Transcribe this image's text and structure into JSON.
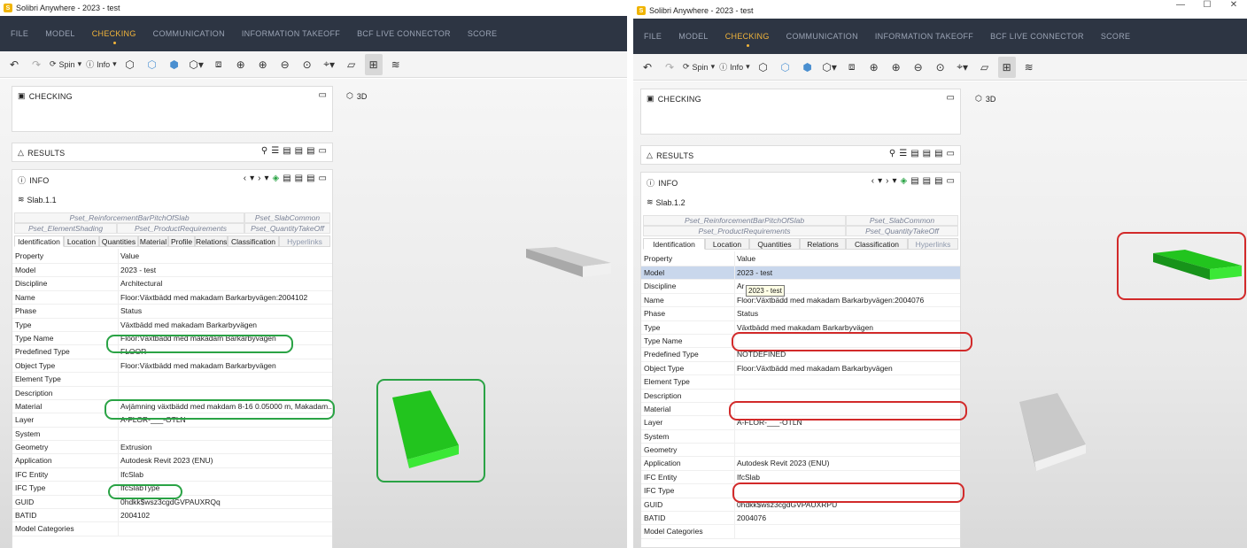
{
  "windows": [
    {
      "title": "Solibri Anywhere - 2023 - test",
      "window_controls": [
        "—",
        "☐",
        "✕"
      ],
      "menu": [
        "FILE",
        "MODEL",
        "CHECKING",
        "COMMUNICATION",
        "INFORMATION TAKEOFF",
        "BCF LIVE CONNECTOR",
        "SCORE"
      ],
      "active_menu": "CHECKING",
      "toolbar": {
        "spin_label": "Spin",
        "info_label": "Info"
      },
      "checking_title": "CHECKING",
      "results_title": "RESULTS",
      "info_title": "INFO",
      "view_title": "3D",
      "object_label": "Slab.1.1",
      "pset_row1": [
        "Pset_ReinforcementBarPitchOfSlab",
        "Pset_SlabCommon"
      ],
      "pset_row2": [
        "Pset_ElementShading",
        "Pset_ProductRequirements",
        "Pset_QuantityTakeOff"
      ],
      "tabs": [
        "Identification",
        "Location",
        "Quantities",
        "Material",
        "Profile",
        "Relations",
        "Classification",
        "Hyperlinks"
      ],
      "table_header": [
        "Property",
        "Value"
      ],
      "rows": [
        {
          "k": "Model",
          "v": "2023 - test"
        },
        {
          "k": "Discipline",
          "v": "Architectural"
        },
        {
          "k": "Name",
          "v": "Floor:Växtbädd med makadam Barkarbyvägen:2004102"
        },
        {
          "k": "Phase",
          "v": "Status"
        },
        {
          "k": "Type",
          "v": "Växtbädd med makadam Barkarbyvägen"
        },
        {
          "k": "Type Name",
          "v": "Floor:Växtbädd med makadam Barkarbyvägen"
        },
        {
          "k": "Predefined Type",
          "v": "FLOOR"
        },
        {
          "k": "Object Type",
          "v": "Floor:Växtbädd med makadam Barkarbyvägen"
        },
        {
          "k": "Element Type",
          "v": ""
        },
        {
          "k": "Description",
          "v": ""
        },
        {
          "k": "Material",
          "v": "Avjämning växtbädd med makdam  8-16 0.05000 m, Makadam..."
        },
        {
          "k": "Layer",
          "v": "A-FLOR-___-OTLN"
        },
        {
          "k": "System",
          "v": ""
        },
        {
          "k": "Geometry",
          "v": "Extrusion"
        },
        {
          "k": "Application",
          "v": "Autodesk Revit 2023 (ENU)"
        },
        {
          "k": "IFC Entity",
          "v": "IfcSlab"
        },
        {
          "k": "IFC Type",
          "v": "IfcSlabType"
        },
        {
          "k": "GUID",
          "v": "0hdkk$wsz3cgdGVPAUXRQq"
        },
        {
          "k": "BATID",
          "v": "2004102"
        },
        {
          "k": "Model Categories",
          "v": ""
        }
      ],
      "slab_color": "#22c41e"
    },
    {
      "title": "Solibri Anywhere - 2023 - test",
      "window_controls": [
        "—",
        "☐",
        "✕"
      ],
      "menu": [
        "FILE",
        "MODEL",
        "CHECKING",
        "COMMUNICATION",
        "INFORMATION TAKEOFF",
        "BCF LIVE CONNECTOR",
        "SCORE"
      ],
      "active_menu": "CHECKING",
      "toolbar": {
        "spin_label": "Spin",
        "info_label": "Info"
      },
      "checking_title": "CHECKING",
      "results_title": "RESULTS",
      "info_title": "INFO",
      "view_title": "3D",
      "object_label": "Slab.1.2",
      "pset_row1": [
        "Pset_ReinforcementBarPitchOfSlab",
        "Pset_SlabCommon"
      ],
      "pset_row2": [
        "Pset_ProductRequirements",
        "Pset_QuantityTakeOff"
      ],
      "tabs": [
        "Identification",
        "Location",
        "Quantities",
        "Relations",
        "Classification",
        "Hyperlinks"
      ],
      "table_header": [
        "Property",
        "Value"
      ],
      "tooltip": "2023 - test",
      "rows": [
        {
          "k": "Model",
          "v": "2023 - test"
        },
        {
          "k": "Discipline",
          "v": "Ar"
        },
        {
          "k": "Name",
          "v": "Floor:Växtbädd med makadam Barkarbyvägen:2004076"
        },
        {
          "k": "Phase",
          "v": "Status"
        },
        {
          "k": "Type",
          "v": "Växtbädd med makadam Barkarbyvägen"
        },
        {
          "k": "Type Name",
          "v": ""
        },
        {
          "k": "Predefined Type",
          "v": "NOTDEFINED"
        },
        {
          "k": "Object Type",
          "v": "Floor:Växtbädd med makadam Barkarbyvägen"
        },
        {
          "k": "Element Type",
          "v": ""
        },
        {
          "k": "Description",
          "v": ""
        },
        {
          "k": "Material",
          "v": ""
        },
        {
          "k": "Layer",
          "v": "A-FLOR-___-OTLN"
        },
        {
          "k": "System",
          "v": ""
        },
        {
          "k": "Geometry",
          "v": ""
        },
        {
          "k": "Application",
          "v": "Autodesk Revit 2023 (ENU)"
        },
        {
          "k": "IFC Entity",
          "v": "IfcSlab"
        },
        {
          "k": "IFC Type",
          "v": ""
        },
        {
          "k": "GUID",
          "v": "0hdkk$wsz3cgdGVPAUXRPU"
        },
        {
          "k": "BATID",
          "v": "2004076"
        },
        {
          "k": "Model Categories",
          "v": ""
        }
      ],
      "slab_color": "#22c41e"
    }
  ],
  "annotation_colors": {
    "ok": "#2aa345",
    "missing": "#d22a2a"
  }
}
